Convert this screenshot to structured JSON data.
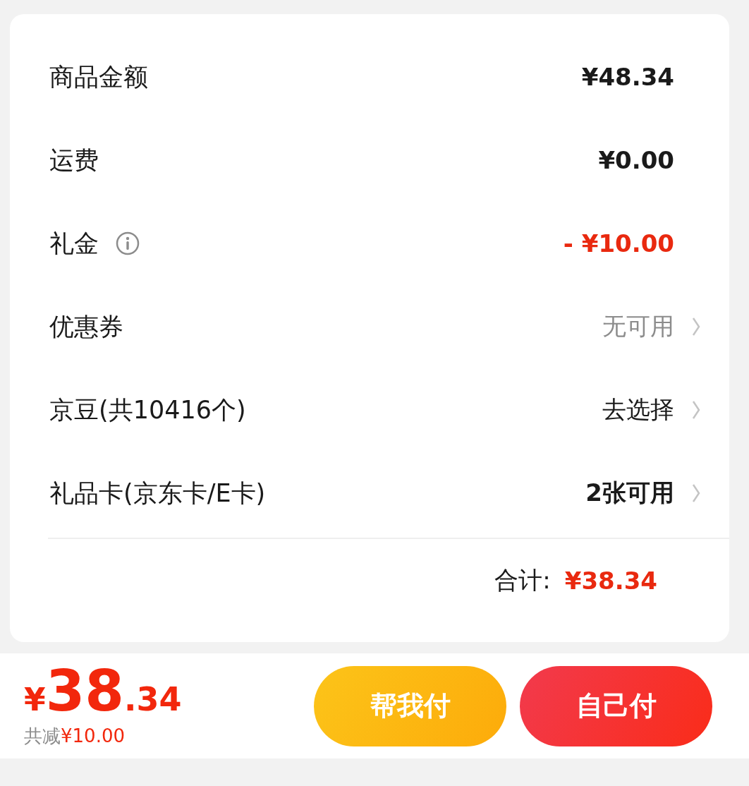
{
  "summary": {
    "rows": [
      {
        "label": "商品金额",
        "value": "¥48.34",
        "kind": "amount",
        "info": false
      },
      {
        "label": "运费",
        "value": "¥0.00",
        "kind": "amount",
        "info": false
      },
      {
        "label": "礼金",
        "value": "- ¥10.00",
        "kind": "discount",
        "info": true
      },
      {
        "label": "优惠券",
        "value": "无可用",
        "kind": "unavailable",
        "info": false
      },
      {
        "label": "京豆(共10416个)",
        "value": "去选择",
        "kind": "action",
        "info": false
      },
      {
        "label": "礼品卡(京东卡/E卡)",
        "value": "2张可用",
        "kind": "available",
        "info": false
      }
    ],
    "total": {
      "label": "合计:",
      "value": "¥38.34"
    }
  },
  "footer": {
    "price": {
      "currency": "¥",
      "integer": "38",
      "decimal": ".34"
    },
    "saving": {
      "label": "共减",
      "value": "¥10.00"
    },
    "buttons": [
      {
        "label": "帮我付",
        "kind": "secondary"
      },
      {
        "label": "自己付",
        "kind": "primary"
      }
    ]
  }
}
